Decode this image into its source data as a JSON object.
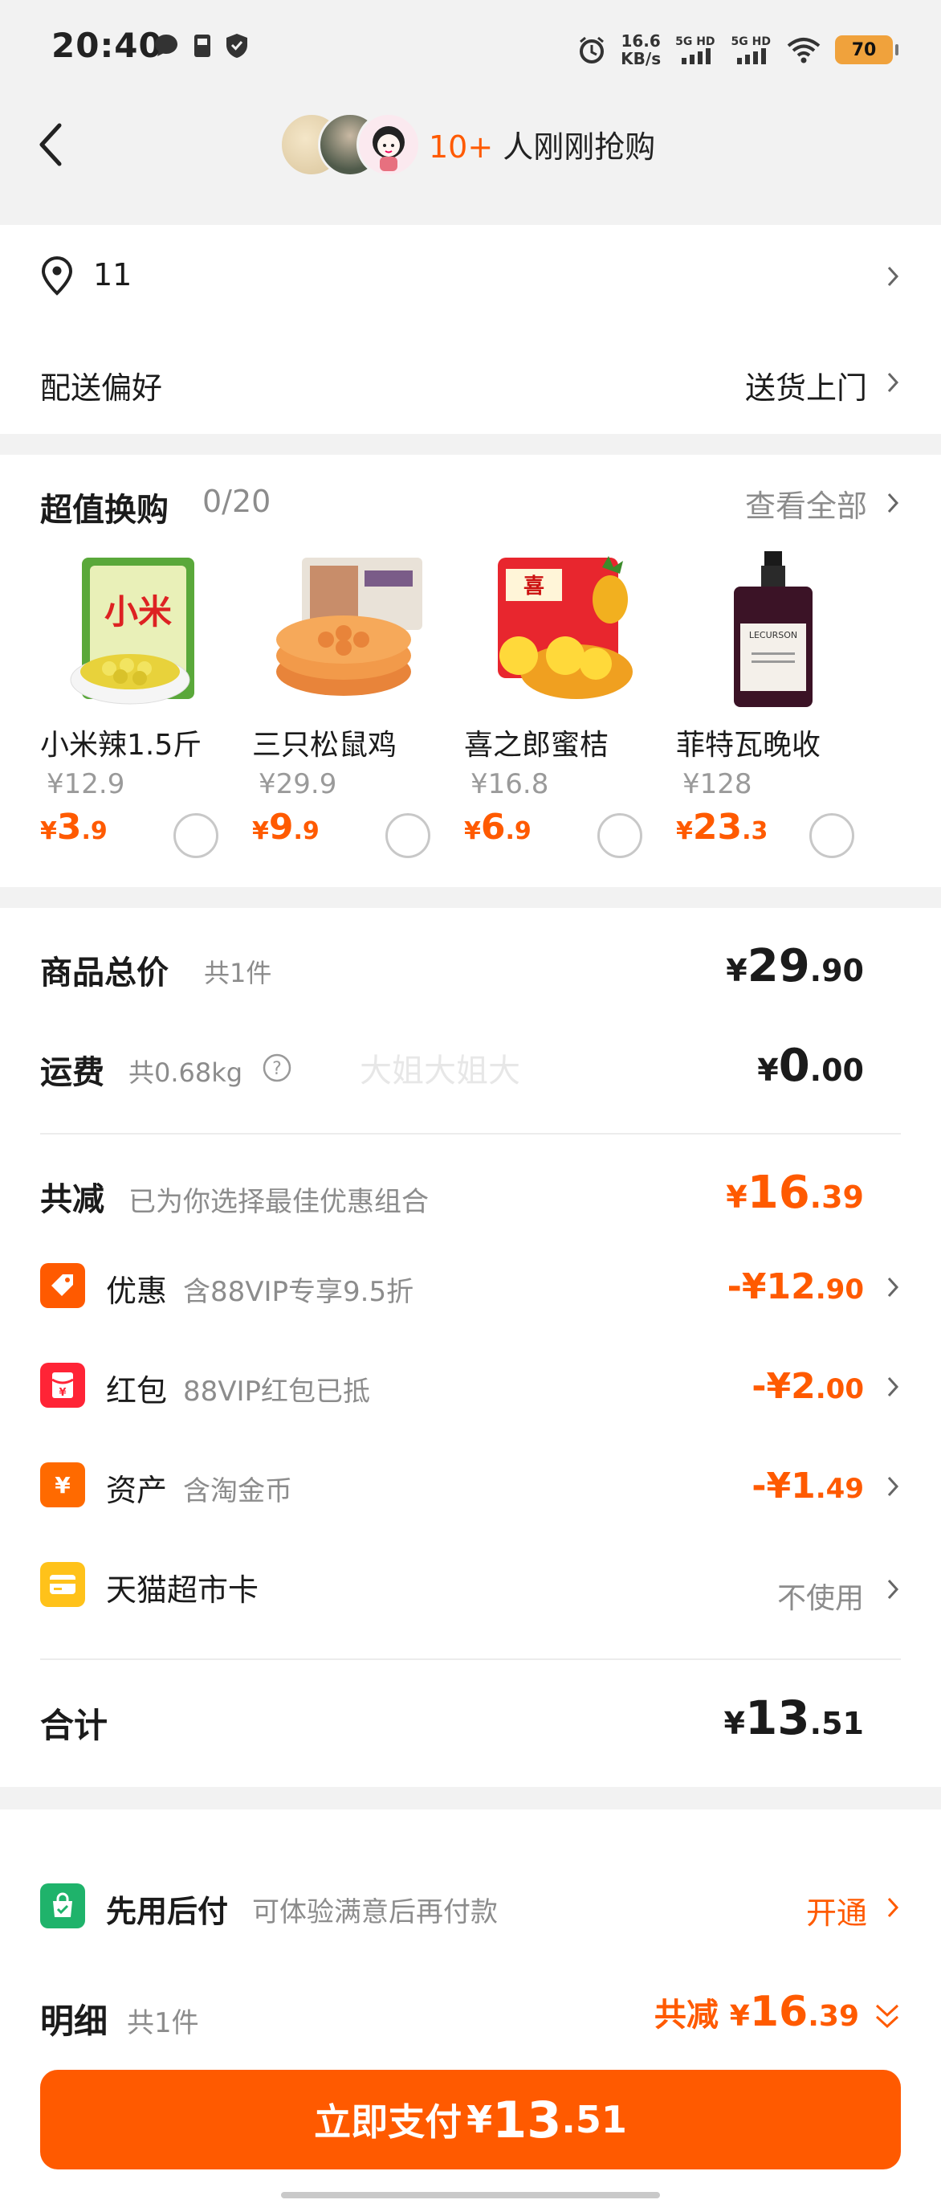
{
  "status_bar": {
    "time": "20:40",
    "net_speed_value": "16.6",
    "net_speed_unit": "KB/s",
    "signal1": "5G HD",
    "signal2": "5G HD",
    "battery": "70"
  },
  "header": {
    "buyers_count": "10+",
    "buyers_text": " 人刚刚抢购"
  },
  "address": {
    "value": "11",
    "delivery_label": "配送偏好",
    "delivery_value": "送货上门"
  },
  "exchange": {
    "title": "超值换购",
    "progress": "0/20",
    "view_all": "查看全部",
    "items": [
      {
        "name": "小米辣1.5斤",
        "orig": "¥12.9",
        "price_int": "3",
        "price_dec": ".9"
      },
      {
        "name": "三只松鼠鸡",
        "orig": "¥29.9",
        "price_int": "9",
        "price_dec": ".9"
      },
      {
        "name": "喜之郎蜜桔",
        "orig": "¥16.8",
        "price_int": "6",
        "price_dec": ".9"
      },
      {
        "name": "菲特瓦晚收",
        "orig": "¥128",
        "price_int": "23",
        "price_dec": ".3"
      }
    ]
  },
  "summary": {
    "goods_label": "商品总价",
    "goods_count": "共1件",
    "goods_int": "29",
    "goods_dec": ".90",
    "shipping_label": "运费",
    "shipping_weight": "共0.68kg",
    "shipping_int": "0",
    "shipping_dec": ".00",
    "reduce_label": "共减",
    "reduce_desc": "已为你选择最佳优惠组合",
    "reduce_int": "16",
    "reduce_dec": ".39",
    "discounts": [
      {
        "label": "优惠",
        "desc": "含88VIP专享9.5折",
        "int": "-¥12",
        "dec": ".90"
      },
      {
        "label": "红包",
        "desc": "88VIP红包已抵",
        "int": "-¥2",
        "dec": ".00"
      },
      {
        "label": "资产",
        "desc": "含淘金币",
        "int": "-¥1",
        "dec": ".49"
      }
    ],
    "card_label": "天猫超市卡",
    "card_value": "不使用",
    "total_label": "合计",
    "total_int": "13",
    "total_dec": ".51"
  },
  "watermark": "大姐大姐大",
  "footer": {
    "paylater_label": "先用后付",
    "paylater_desc": "可体验满意后再付款",
    "paylater_action": "开通",
    "detail_label": "明细",
    "detail_count": "共1件",
    "detail_reduce_label": "共减 ",
    "detail_reduce_int": "16",
    "detail_reduce_dec": ".39",
    "pay_label": "立即支付",
    "pay_int": "13",
    "pay_dec": ".51"
  },
  "colors": {
    "accent": "#ff5a00",
    "badge_discount": "#ff5a00",
    "badge_redpacket": "#ff2436",
    "badge_asset": "#ff6a00",
    "badge_card": "#ffc21a",
    "badge_paylater": "#1fb36b"
  }
}
